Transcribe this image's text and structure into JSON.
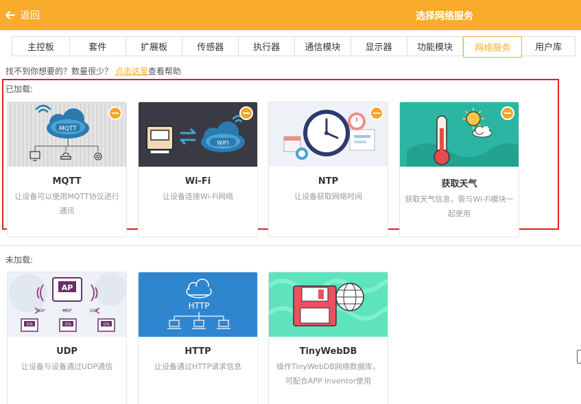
{
  "header": {
    "back_label": "返回",
    "title": "选择网络服务"
  },
  "tabs": [
    "主控板",
    "套件",
    "扩展板",
    "传感器",
    "执行器",
    "通信模块",
    "显示器",
    "功能模块",
    "网络服务",
    "用户库"
  ],
  "help": {
    "text1": "找不到你想要的？数量很少？",
    "link": "点击这里",
    "text2": "查看帮助"
  },
  "loaded": {
    "label": "已加载:",
    "cards": [
      {
        "name": "MQTT",
        "desc": "让设备可以使用MQTT协议进行通讯"
      },
      {
        "name": "Wi-Fi",
        "desc": "让设备连接Wi-Fi网络"
      },
      {
        "name": "NTP",
        "desc": "让设备获取网络时间"
      },
      {
        "name": "获取天气",
        "desc": "获取天气信息，需与Wi-Fi模块一起使用"
      }
    ]
  },
  "unloaded": {
    "label": "未加载:",
    "cards": [
      {
        "name": "UDP",
        "desc": "让设备与设备通过UDP通信"
      },
      {
        "name": "HTTP",
        "desc": "让设备通过HTTP请求信息"
      },
      {
        "name": "TinyWebDB",
        "desc": "操作TinyWebDB网络数据库，可配合APP Inventor使用"
      }
    ]
  },
  "image_text": {
    "mqtt_cloud": "MQTT",
    "wifi_cloud": "WIFI",
    "http_label": "HTTP",
    "udp_ap": "AP",
    "udp_tag": "UDP",
    "sta_tag": "STA"
  },
  "colors": {
    "accent": "#f9ac2c",
    "highlight_box": "#e02020",
    "minus_badge": "#f5a623"
  },
  "icons": {
    "back": "back-arrow-icon",
    "remove": "minus-circle-icon"
  }
}
